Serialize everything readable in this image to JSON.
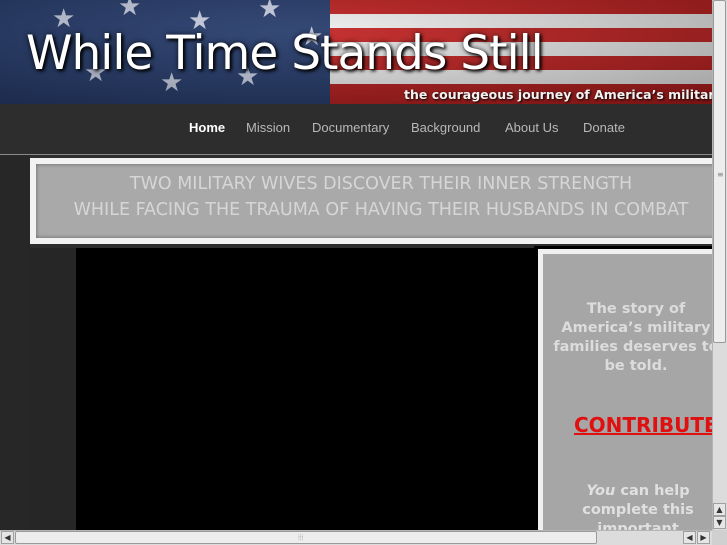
{
  "site": {
    "title": "While Time Stands Still",
    "tagline": "the courageous journey of America’s military families"
  },
  "nav": {
    "items": [
      {
        "label": "Home",
        "active": true
      },
      {
        "label": "Mission"
      },
      {
        "label": "Documentary"
      },
      {
        "label": "Background"
      },
      {
        "label": "About Us"
      },
      {
        "label": "Donate"
      }
    ]
  },
  "slogan": {
    "line1": "TWO MILITARY WIVES DISCOVER THEIR INNER STRENGTH",
    "line2": "WHILE FACING THE TRAUMA OF HAVING THEIR HUSBANDS IN COMBAT"
  },
  "sidebar": {
    "story_lines": [
      "The story of",
      "America’s military",
      "families deserves to",
      "be told."
    ],
    "contribute_label": "CONTRIBUTE",
    "help_em": "You",
    "help_rest": " can help complete this important"
  },
  "colors": {
    "contribute": "#e01010",
    "nav_active": "#ffffff",
    "nav_inactive": "#b8b8b8"
  },
  "scrollbars": {
    "vertical_icons": [
      "scroll-up-icon",
      "scroll-down-icon"
    ],
    "horizontal_icons": [
      "scroll-left-icon",
      "scroll-right-icon"
    ]
  }
}
